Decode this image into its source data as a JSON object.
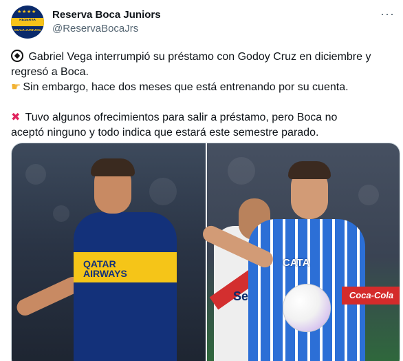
{
  "author": {
    "display_name": "Reserva Boca Juniors",
    "handle": "@ReservaBocaJrs",
    "avatar_text_top": "RESERVA",
    "avatar_text_bottom": "BOCA JUNIORS"
  },
  "more_label": "···",
  "tweet": {
    "lines": [
      {
        "icon": "soccer-ball-icon",
        "text": "Gabriel Vega interrumpió su préstamo con Godoy Cruz en diciembre y"
      },
      {
        "icon": null,
        "text": "regresó a Boca."
      },
      {
        "icon": "pointing-hand-icon",
        "text": "Sin embargo, hace dos meses que está entrenando por su cuenta."
      },
      {
        "icon": "cross-mark-icon",
        "text": "Tuvo algunos ofrecimientos para salir a préstamo, pero Boca no"
      },
      {
        "icon": null,
        "text": "aceptó ninguno y todo indica que estará este semestre parado."
      }
    ]
  },
  "media": {
    "left_sponsor": "QATAR AIRWAYS",
    "right_sponsor": "CATA",
    "player2_sponsor": "Sec",
    "adboard": "Coca-Cola"
  },
  "colors": {
    "boca_blue": "#13317a",
    "boca_gold": "#f5c518",
    "godoy_blue": "#2c6fd6",
    "text_primary": "#0f1419",
    "text_secondary": "#536471"
  }
}
